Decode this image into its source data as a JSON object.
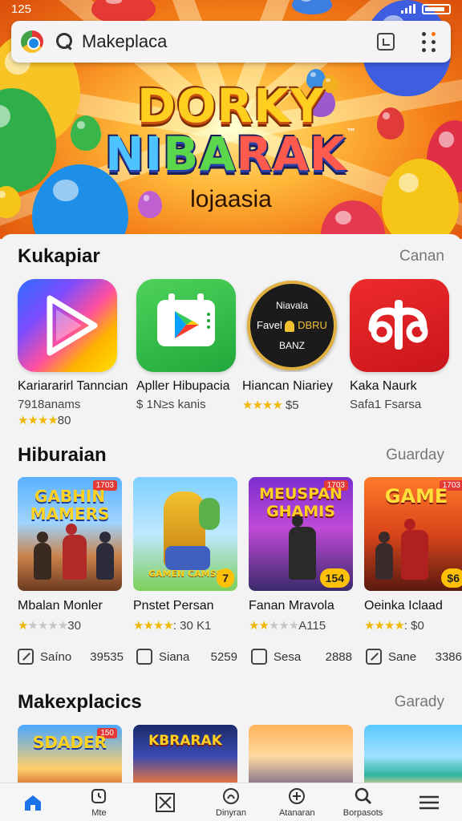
{
  "status": {
    "time": "125"
  },
  "search": {
    "text": "Makeplaca"
  },
  "hero": {
    "line1": "DORKY",
    "line2_a": "NI",
    "line2_b": "BA",
    "line2_c": "RAK",
    "tm": "™",
    "subtitle": "lojaasia"
  },
  "sections": [
    {
      "title": "Kukapiar",
      "link": "Canan"
    },
    {
      "title": "Hiburaian",
      "link": "Guarday"
    },
    {
      "title": "Makexplacics",
      "link": "Garady"
    }
  ],
  "apps": [
    {
      "name": "Kariararirl Tanncian",
      "meta": "7918anams",
      "stars": 4,
      "rating": "80"
    },
    {
      "name": "Apller Hibupacia",
      "meta": "$ 1N≥s kanis",
      "stars": 0,
      "rating": ""
    },
    {
      "name": "Hiancan Niariey",
      "meta": "",
      "stars": 4,
      "rating": "$5"
    },
    {
      "name": "Kaka Naurk",
      "meta": "Safa1 Fsarsa",
      "stars": 0,
      "rating": ""
    }
  ],
  "app3_icon_text": {
    "l1": "Niavala",
    "l2a": "Favel",
    "l2b": "DBRU",
    "l3": "BANZ"
  },
  "games": [
    {
      "cover": "GABHIN MAMERS",
      "cover_a": "GABHIN",
      "cover_b": "MAMERS",
      "badge": "1703",
      "price": "",
      "name": "Mbalan Monler",
      "stars": 1,
      "rating": "30",
      "foot_label": "Saíno",
      "foot_size": "39535"
    },
    {
      "cover": "GAMEN CAMSS",
      "badge": "",
      "price": "7",
      "name": "Pnstet Persan",
      "stars": 4,
      "rating": ": 30 K1",
      "foot_label": "Siana",
      "foot_size": "5259"
    },
    {
      "cover_a": "MEUSPAN",
      "cover_b": "GHAMIS",
      "badge": "1703",
      "price": "154",
      "name": "Fanan Mravola",
      "stars": 2,
      "rating": "A115",
      "foot_label": "Sesa",
      "foot_size": "2888"
    },
    {
      "cover_a": "GAME",
      "badge": "1703",
      "price": "$6",
      "name": "Oeinka Iclaad",
      "stars": 4,
      "rating": ": $0",
      "foot_label": "Sane",
      "foot_size": "3386"
    }
  ],
  "thumbs": [
    {
      "cover": "SDADER",
      "badge": "150"
    },
    {
      "cover": "KBRARAK",
      "badge": ""
    }
  ],
  "nav": [
    {
      "label": ""
    },
    {
      "label": "Mte"
    },
    {
      "label": ""
    },
    {
      "label": "Dinyran"
    },
    {
      "label": "Atanaran"
    },
    {
      "label": "Borpasots"
    },
    {
      "label": ""
    }
  ],
  "colors": {
    "accent": "#1a73e8",
    "star": "#f2b705",
    "price": "#ffc107"
  }
}
